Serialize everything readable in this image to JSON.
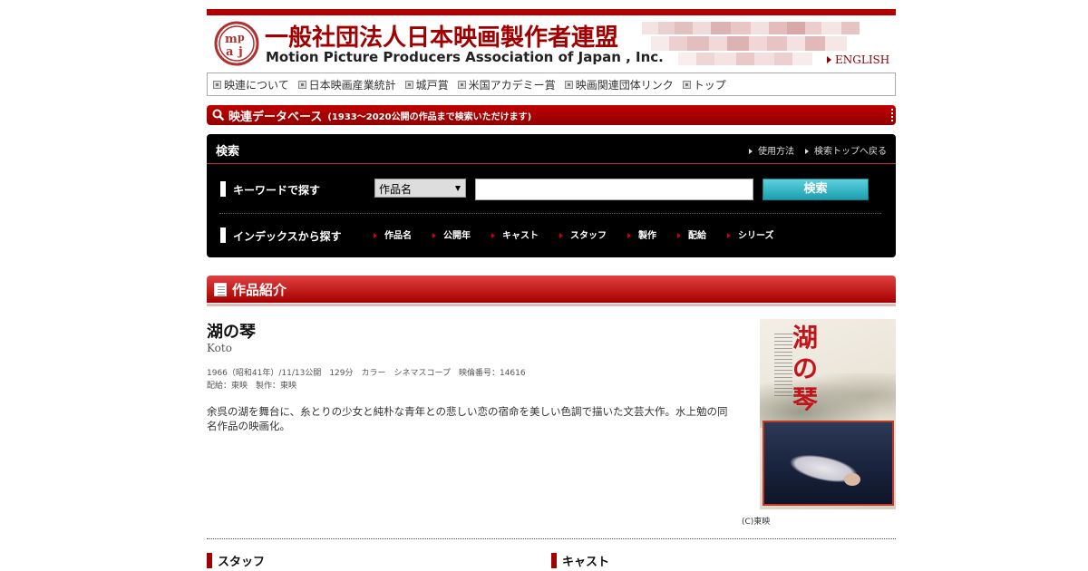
{
  "header": {
    "org_name_jp": "一般社団法人日本映画製作者連盟",
    "org_name_en": "Motion Picture Producers Association of Japan , Inc.",
    "english_link": "ENGLISH",
    "brand_color": "#a10000"
  },
  "nav": {
    "items": [
      {
        "label": "映連について"
      },
      {
        "label": "日本映画産業統計"
      },
      {
        "label": "城戸賞"
      },
      {
        "label": "米国アカデミー賞"
      },
      {
        "label": "映画関連団体リンク"
      },
      {
        "label": "トップ"
      }
    ]
  },
  "database_bar": {
    "title": "映連データベース",
    "subtitle": "(1933～2020公開の作品まで検索いただけます)"
  },
  "search": {
    "title": "検索",
    "links": [
      "使用方法",
      "検索トップへ戻る"
    ],
    "keyword_label": "キーワードで探す",
    "select_value": "作品名",
    "input_value": "",
    "button_label": "検索",
    "button_color": "#1b9fb0",
    "index_label": "インデックスから探す",
    "index_links": [
      "作品名",
      "公開年",
      "キャスト",
      "スタッフ",
      "製作",
      "配給",
      "シリーズ"
    ]
  },
  "section": {
    "title": "作品紹介"
  },
  "film": {
    "title": "湖の琴",
    "title_en": "Koto",
    "meta_line1": "1966（昭和41年）/11/13公開　129分　カラー　シネマスコープ　映倫番号：14616",
    "meta_line2": "配給：東映　製作：東映",
    "synopsis": "余呉の湖を舞台に、糸とりの少女と純朴な青年との悲しい恋の宿命を美しい色調で描いた文芸大作。水上勉の同名作品の映画化。",
    "poster_title": "湖の琴",
    "copyright": "(C)東映"
  },
  "subsections": {
    "staff": "スタッフ",
    "cast": "キャスト"
  }
}
